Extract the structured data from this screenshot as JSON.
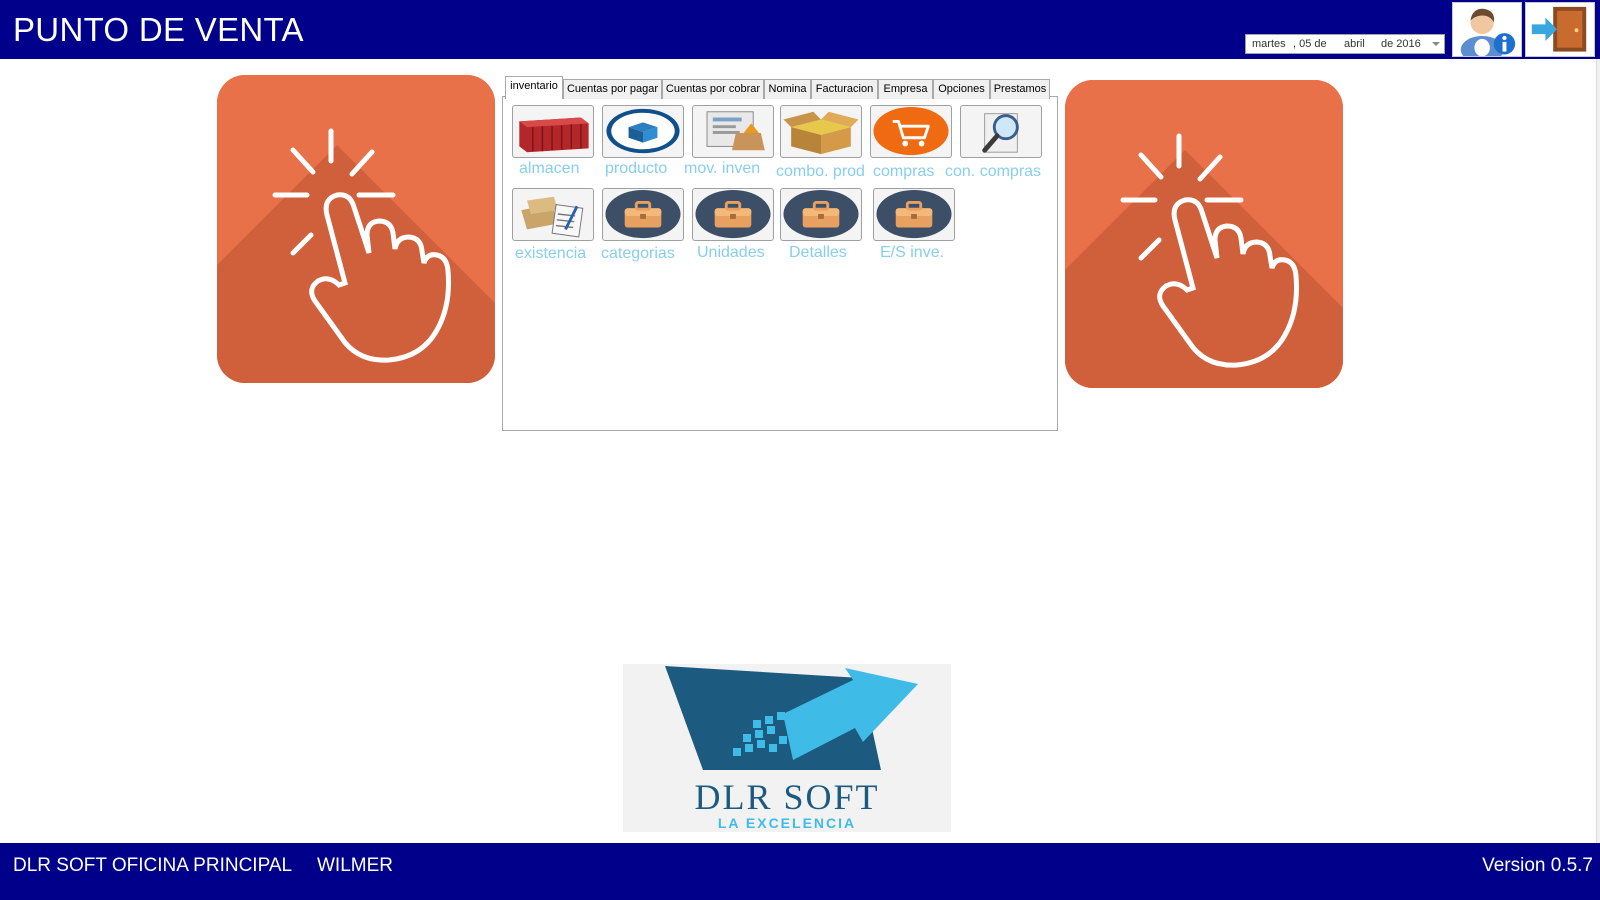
{
  "header": {
    "title": "PUNTO DE VENTA",
    "date": {
      "weekday": "martes",
      "day": ", 05 de",
      "month": "abril",
      "year": "de 2016"
    }
  },
  "tabs": [
    {
      "label": "inventario"
    },
    {
      "label": "Cuentas por pagar"
    },
    {
      "label": "Cuentas por cobrar"
    },
    {
      "label": "Nomina"
    },
    {
      "label": "Facturacion"
    },
    {
      "label": "Empresa"
    },
    {
      "label": "Opciones"
    },
    {
      "label": "Prestamos"
    }
  ],
  "modules": [
    {
      "label": "almacen",
      "icon": "container-icon"
    },
    {
      "label": "producto",
      "icon": "product-box-icon"
    },
    {
      "label": "mov. inven",
      "icon": "inventory-movement-icon"
    },
    {
      "label": "combo. prod",
      "icon": "open-box-icon"
    },
    {
      "label": "compras",
      "icon": "shopping-cart-icon"
    },
    {
      "label": "con. compras",
      "icon": "magnifier-icon"
    },
    {
      "label": "existencia",
      "icon": "stock-checklist-icon"
    },
    {
      "label": "categorias",
      "icon": "briefcase-icon"
    },
    {
      "label": "Unidades",
      "icon": "briefcase-icon"
    },
    {
      "label": "Detalles",
      "icon": "briefcase-icon"
    },
    {
      "label": "E/S inve.",
      "icon": "briefcase-icon"
    }
  ],
  "logo": {
    "name": "DLR SOFT",
    "tagline": "LA EXCELENCIA"
  },
  "footer": {
    "office": "DLR SOFT OFICINA PRINCIPAL",
    "user": "WILMER",
    "version": "Version 0.5.7"
  },
  "colors": {
    "header_bg": "#00008b",
    "tile_orange": "#e8714a",
    "module_label": "#87cef0",
    "logo_dark": "#1d5a80",
    "logo_light": "#3fbbe8"
  }
}
